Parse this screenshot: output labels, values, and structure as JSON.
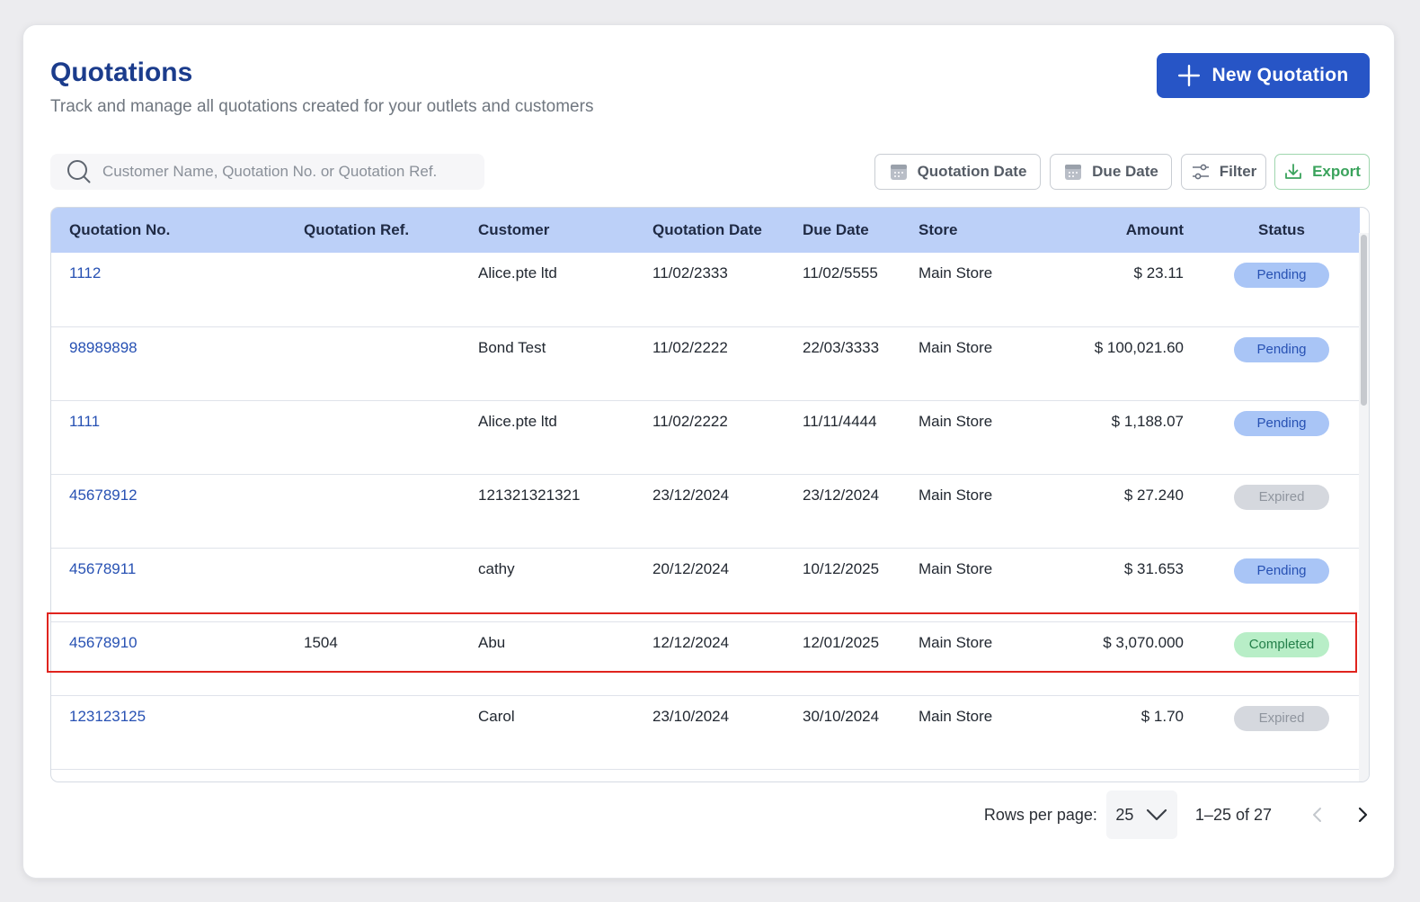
{
  "header": {
    "title": "Quotations",
    "subtitle": "Track and manage all quotations created for your outlets and customers",
    "new_button_label": "New Quotation"
  },
  "toolbar": {
    "search_placeholder": "Customer Name, Quotation No. or Quotation Ref.",
    "quotation_date_label": "Quotation Date",
    "due_date_label": "Due Date",
    "filter_label": "Filter",
    "export_label": "Export"
  },
  "table": {
    "columns": [
      "Quotation No.",
      "Quotation Ref.",
      "Customer",
      "Quotation Date",
      "Due Date",
      "Store",
      "Amount",
      "Status"
    ],
    "rows": [
      {
        "no": "1112",
        "ref": "",
        "customer": "Alice.pte ltd",
        "qdate": "11/02/2333",
        "due": "11/02/5555",
        "store": "Main Store",
        "amount": "$ 23.11",
        "status": "Pending",
        "status_type": "pending"
      },
      {
        "no": "98989898",
        "ref": "",
        "customer": "Bond Test",
        "qdate": "11/02/2222",
        "due": "22/03/3333",
        "store": "Main Store",
        "amount": "$ 100,021.60",
        "status": "Pending",
        "status_type": "pending"
      },
      {
        "no": "1111",
        "ref": "",
        "customer": "Alice.pte ltd",
        "qdate": "11/02/2222",
        "due": "11/11/4444",
        "store": "Main Store",
        "amount": "$ 1,188.07",
        "status": "Pending",
        "status_type": "pending"
      },
      {
        "no": "45678912",
        "ref": "",
        "customer": "121321321321",
        "qdate": "23/12/2024",
        "due": "23/12/2024",
        "store": "Main Store",
        "amount": "$ 27.240",
        "status": "Expired",
        "status_type": "expired"
      },
      {
        "no": "45678911",
        "ref": "",
        "customer": "cathy",
        "qdate": "20/12/2024",
        "due": "10/12/2025",
        "store": "Main Store",
        "amount": "$ 31.653",
        "status": "Pending",
        "status_type": "pending"
      },
      {
        "no": "45678910",
        "ref": "1504",
        "customer": "Abu",
        "qdate": "12/12/2024",
        "due": "12/01/2025",
        "store": "Main Store",
        "amount": "$ 3,070.000",
        "status": "Completed",
        "status_type": "completed"
      },
      {
        "no": "123123125",
        "ref": "",
        "customer": "Carol",
        "qdate": "23/10/2024",
        "due": "30/10/2024",
        "store": "Main Store",
        "amount": "$ 1.70",
        "status": "Expired",
        "status_type": "expired"
      },
      {
        "no": "",
        "ref": "",
        "customer": "",
        "qdate": "",
        "due": "",
        "store": "",
        "amount": "",
        "status": "",
        "status_type": ""
      }
    ]
  },
  "pagination": {
    "rows_per_page_label": "Rows per page:",
    "rows_per_page_value": "25",
    "range_text": "1–25 of 27"
  },
  "colors": {
    "primary": "#2755c6",
    "title": "#1b3c8c",
    "header_bg": "#bcd0f8",
    "export_green": "#3aa35c",
    "highlight_red": "#e0241e"
  }
}
